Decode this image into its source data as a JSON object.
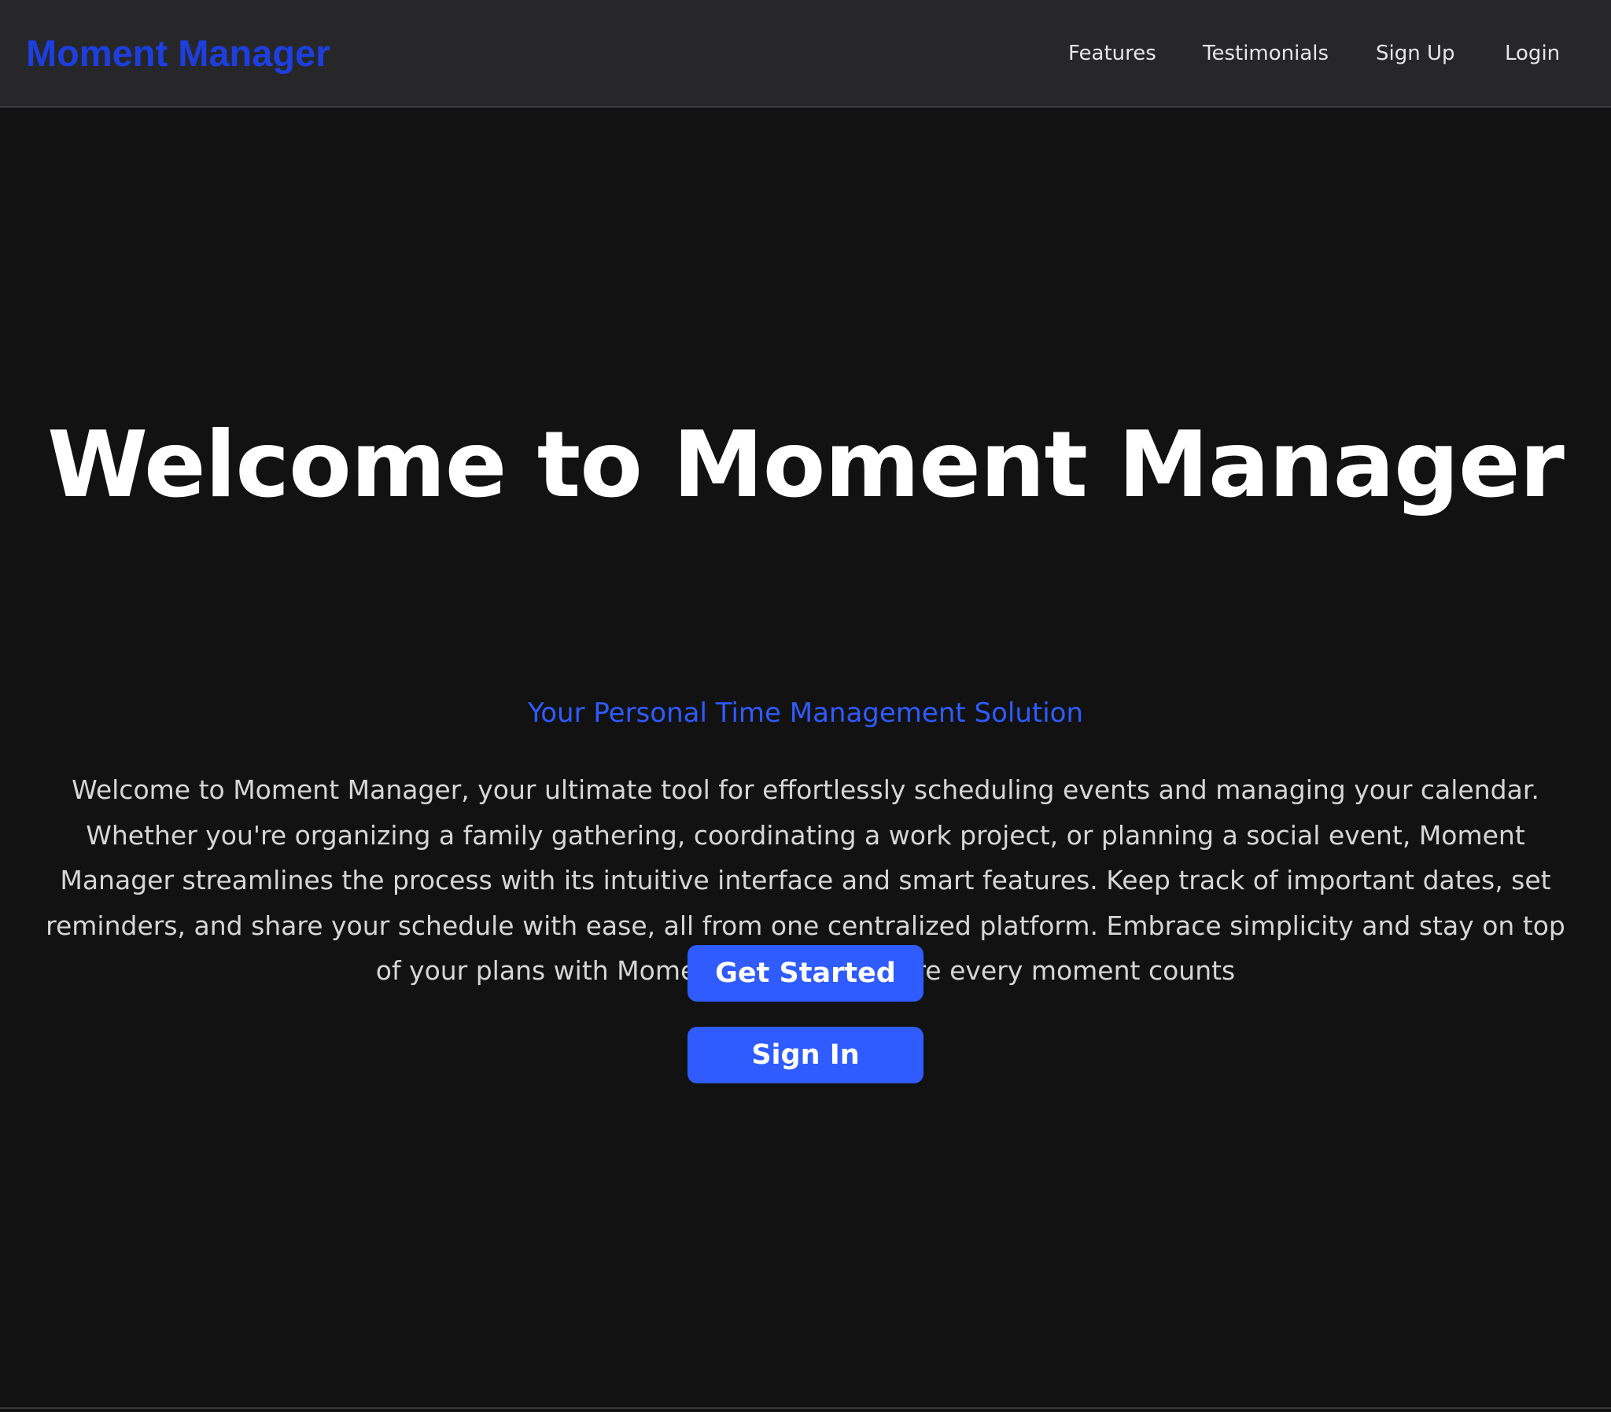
{
  "header": {
    "brand": "Moment Manager",
    "nav": [
      {
        "label": "Features"
      },
      {
        "label": "Testimonials"
      },
      {
        "label": "Sign Up"
      },
      {
        "label": "Login"
      }
    ]
  },
  "hero": {
    "title": "Welcome to Moment Manager",
    "subtitle": "Your Personal Time Management Solution",
    "description": "Welcome to Moment Manager, your ultimate tool for effortlessly scheduling events and managing your calendar. Whether you're organizing a family gathering, coordinating a work project, or planning a social event, Moment Manager streamlines the process with its intuitive interface and smart features. Keep track of important dates, set reminders, and share your schedule with ease, all from one centralized platform. Embrace simplicity and stay on top of your plans with Moment Manager, where every moment counts",
    "primary_button": "Get Started",
    "secondary_button": "Sign In"
  },
  "colors": {
    "background": "#121212",
    "header_background": "#27272a",
    "brand": "#1d3fe0",
    "accent": "#2f5bff",
    "heading_text": "#ffffff",
    "body_text": "#d6d6d6"
  }
}
